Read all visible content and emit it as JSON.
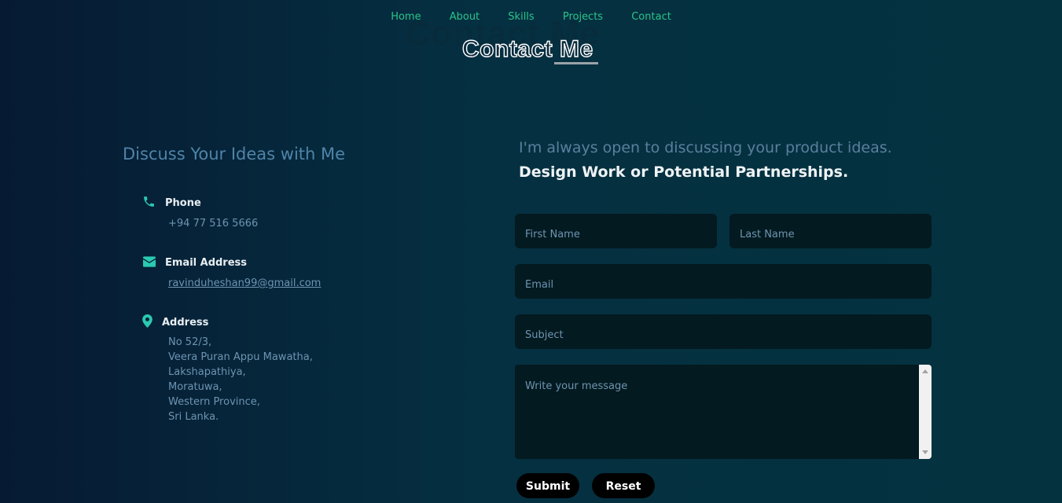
{
  "nav": {
    "items": [
      "Home",
      "About",
      "Skills",
      "Projects",
      "Contact"
    ]
  },
  "section": {
    "ghost_title": "Contact Me",
    "title": "Contact Me"
  },
  "left": {
    "heading": "Discuss Your Ideas with Me",
    "phone": {
      "label": "Phone",
      "value": "+94 77 516 5666",
      "icon": "phone-icon"
    },
    "email": {
      "label": "Email Address",
      "value": "ravinduheshan99@gmail.com",
      "icon": "envelope-icon"
    },
    "address": {
      "label": "Address",
      "icon": "map-pin-icon",
      "lines": [
        "No 52/3,",
        "Veera Puran Appu Mawatha,",
        "Lakshapathiya,",
        "Moratuwa,",
        "Western Province,",
        "Sri Lanka."
      ]
    }
  },
  "form": {
    "intro_line1": "I'm always open to discussing your product ideas.",
    "intro_line2": "Design Work or Potential Partnerships.",
    "first_name_placeholder": "First Name",
    "last_name_placeholder": "Last Name",
    "email_placeholder": "Email",
    "subject_placeholder": "Subject",
    "message_placeholder": "Write your message",
    "submit_label": "Submit",
    "reset_label": "Reset"
  },
  "colors": {
    "accent": "#2bc48a",
    "icon": "#2bc9b0",
    "muted_text": "#6e94b1",
    "field_bg": "#031a20"
  }
}
